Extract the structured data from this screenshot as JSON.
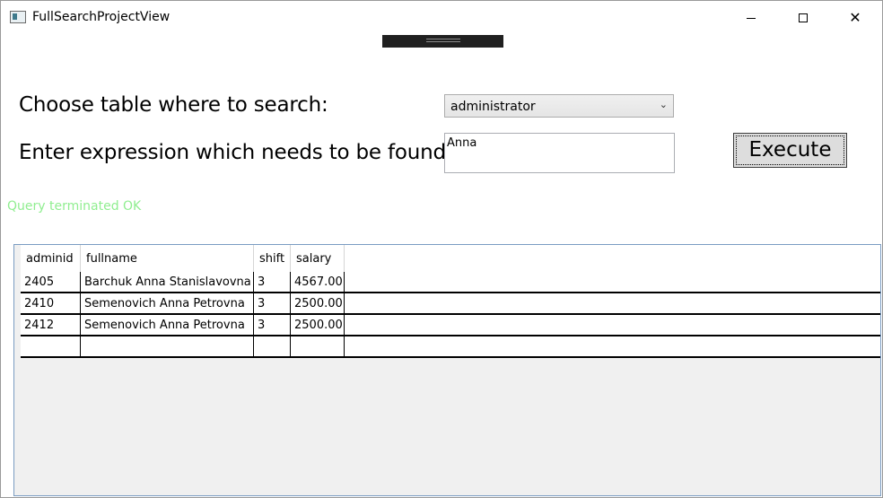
{
  "window": {
    "title": "FullSearchProjectView",
    "controls": [
      "minimize-icon",
      "maximize-icon",
      "close-icon"
    ]
  },
  "form": {
    "table_label": "Choose table where to search:",
    "table_selected": "administrator",
    "expression_label": "Enter expression which needs to be found:",
    "expression_value": "Anna",
    "execute_label": "Execute"
  },
  "status": {
    "text": "Query terminated OK",
    "color": "#90ee90"
  },
  "table": {
    "columns": [
      "adminid",
      "fullname",
      "shift",
      "salary"
    ],
    "rows": [
      [
        "2405",
        "Barchuk Anna Stanislavovna",
        "3",
        "4567.00"
      ],
      [
        "2410",
        "Semenovich Anna Petrovna",
        "3",
        "2500.00"
      ],
      [
        "2412",
        "Semenovich Anna Petrovna",
        "3",
        "2500.00"
      ]
    ]
  }
}
